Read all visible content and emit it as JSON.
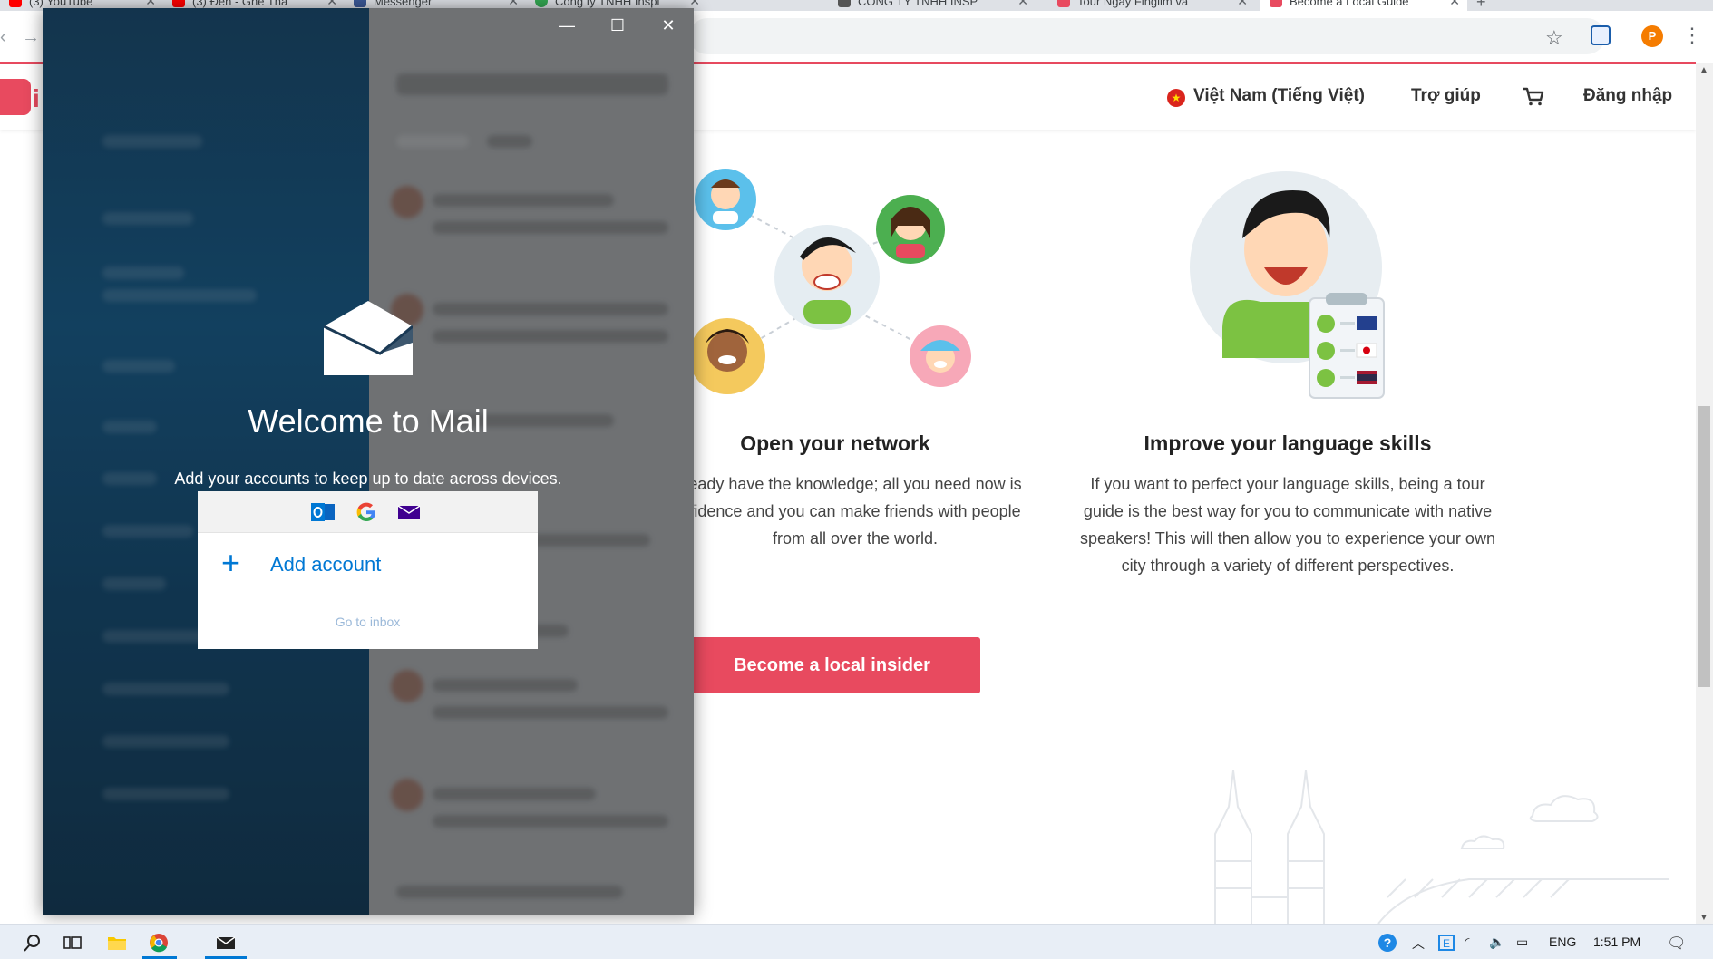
{
  "browser": {
    "tabs": [
      {
        "title": "(3) YouTube",
        "favicon_color": "#ff0000"
      },
      {
        "title": "(3) Đen - Ghé Thă",
        "favicon_color": "#ff0000"
      },
      {
        "title": "Messenger",
        "favicon_color": "#3b5998"
      },
      {
        "title": "Công ty TNHH Inspi",
        "favicon_color": "#34a853"
      },
      {
        "title": "CÔNG TY TNHH INSP",
        "favicon_color": "#555555"
      },
      {
        "title": "Tour Ngày Fingilm và",
        "favicon_color": "#e84a5f"
      },
      {
        "title": "Become a Local Guide",
        "favicon_color": "#e84a5f",
        "active": true
      }
    ],
    "profile_initial": "P"
  },
  "site": {
    "logo_text": "i",
    "header": {
      "language": "Việt Nam (Tiếng Việt)",
      "help": "Trợ giúp",
      "login": "Đăng nhập"
    },
    "cards": [
      {
        "title": "Open your network",
        "body": "eady have the knowledge; all you need now is fidence and you can make friends with people from all over the world."
      },
      {
        "title": "Improve your language skills",
        "body": "If you want to perfect your language skills, being a tour guide is the best way for you to communicate with native speakers! This will then allow you to experience your own city through a variety of different perspectives."
      }
    ],
    "cta_label": "Become a local insider",
    "accent_color": "#e84a5f"
  },
  "mail": {
    "welcome_title": "Welcome to Mail",
    "welcome_subtitle": "Add your accounts to keep up to date across devices.",
    "add_account_label": "Add account",
    "go_to_inbox_label": "Go to inbox",
    "providers": [
      "outlook-icon",
      "google-icon",
      "yahoo-mail-icon"
    ],
    "accent_color": "#0078d4"
  },
  "taskbar": {
    "language": "ENG",
    "time": "1:51 PM"
  }
}
